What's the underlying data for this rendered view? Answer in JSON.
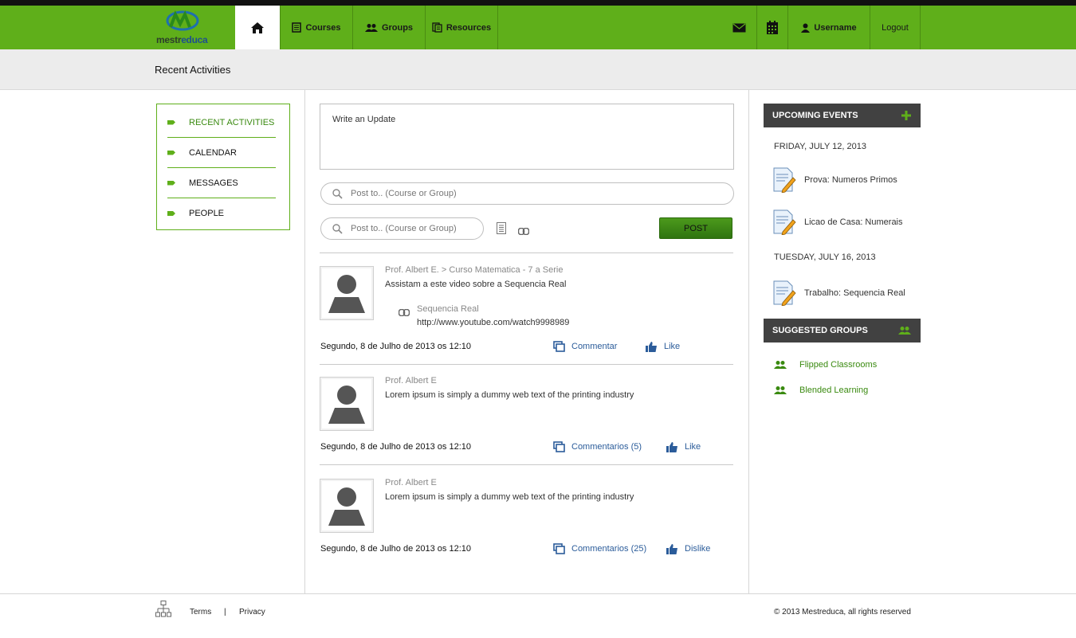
{
  "brand": {
    "logo_text_a": "mestr",
    "logo_text_b": "educa"
  },
  "nav": {
    "courses": "Courses",
    "groups": "Groups",
    "resources": "Resources",
    "username": "Username",
    "logout": "Logout"
  },
  "page_title": "Recent Activities",
  "sidebar": {
    "items": [
      {
        "label": "RECENT ACTIVITIES"
      },
      {
        "label": "CALENDAR"
      },
      {
        "label": "MESSAGES"
      },
      {
        "label": "PEOPLE"
      }
    ]
  },
  "composer": {
    "update_placeholder": "Write an Update",
    "postto_placeholder": "Post to.. (Course or Group)",
    "postto2_placeholder": "Post to.. (Course or Group)",
    "post_label": "POST"
  },
  "posts": [
    {
      "author": "Prof. Albert E. > Curso Matematica - 7 a Serie",
      "text": "Assistam a este video sobre a Sequencia Real",
      "link_title": "Sequencia Real",
      "link_url": "http://www.youtube.com/watch9998989",
      "date": "Segundo, 8 de Julho de 2013 os  12:10",
      "comment_label": "Commentar",
      "like_label": "Like"
    },
    {
      "author": "Prof. Albert E",
      "text": "Lorem ipsum is simply a dummy web text of the printing industry",
      "date": "Segundo, 8 de Julho de 2013 os  12:10",
      "comment_label": "Commentarios (5)",
      "like_label": "Like"
    },
    {
      "author": "Prof. Albert E",
      "text": "Lorem ipsum is simply a dummy web text of the printing industry",
      "date": "Segundo, 8 de Julho de 2013 os  12:10",
      "comment_label": "Commentarios (25)",
      "like_label": "Dislike"
    }
  ],
  "events": {
    "title": "UPCOMING EVENTS",
    "day1": "FRIDAY, JULY 12, 2013",
    "e1": "Prova: Numeros Primos",
    "e2": "Licao de Casa: Numerais",
    "day2": "TUESDAY, JULY 16, 2013",
    "e3": "Trabalho: Sequencia Real"
  },
  "groups": {
    "title": "SUGGESTED GROUPS",
    "g1": "Flipped Classrooms",
    "g2": "Blended Learning"
  },
  "footer": {
    "terms": "Terms",
    "sep": "|",
    "privacy": "Privacy",
    "copyright": "© 2013 Mestreduca, all rights reserved"
  },
  "colors": {
    "brand_green": "#5faf1a",
    "link_blue": "#2b5c9a",
    "dark_header": "#414141"
  }
}
